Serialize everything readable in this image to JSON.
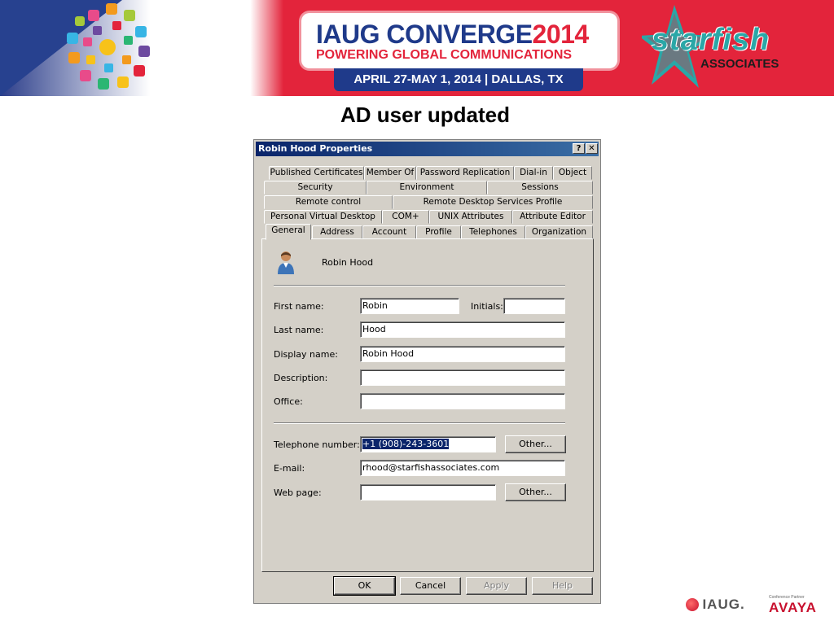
{
  "banner": {
    "title_main": "IAUG CONVERGE",
    "title_year": "2014",
    "subtitle": "POWERING GLOBAL COMMUNICATIONS",
    "dates": "APRIL 27-MAY 1, 2014  |  DALLAS, TX",
    "sponsor_name": "starfish",
    "sponsor_sub": "ASSOCIATES"
  },
  "slide": {
    "title": "AD user updated"
  },
  "dialog": {
    "title": "Robin Hood Properties",
    "help_glyph": "?",
    "close_glyph": "✕",
    "tabs_row1": [
      "Published Certificates",
      "Member Of",
      "Password Replication",
      "Dial-in",
      "Object"
    ],
    "tabs_row2": [
      "Security",
      "Environment",
      "Sessions"
    ],
    "tabs_row3": [
      "Remote control",
      "Remote Desktop Services Profile"
    ],
    "tabs_row4": [
      "Personal Virtual Desktop",
      "COM+",
      "UNIX Attributes",
      "Attribute Editor"
    ],
    "tabs_row5": [
      "General",
      "Address",
      "Account",
      "Profile",
      "Telephones",
      "Organization"
    ],
    "active_tab": "General",
    "user_display": "Robin Hood",
    "labels": {
      "first_name": "First name:",
      "initials": "Initials:",
      "last_name": "Last name:",
      "display_name": "Display name:",
      "description": "Description:",
      "office": "Office:",
      "telephone": "Telephone number:",
      "email": "E-mail:",
      "web_page": "Web page:"
    },
    "values": {
      "first_name": "Robin",
      "initials": "",
      "last_name": "Hood",
      "display_name": "Robin Hood",
      "description": "",
      "office": "",
      "telephone": "+1 (908)-243-3601",
      "email": "rhood@starfishassociates.com",
      "web_page": ""
    },
    "buttons": {
      "other_phone": "Other...",
      "other_web": "Other...",
      "ok": "OK",
      "cancel": "Cancel",
      "apply": "Apply",
      "help": "Help"
    }
  },
  "footer": {
    "iaug": "IAUG.",
    "avaya_partner": "Conference Partner",
    "avaya": "AVAYA"
  },
  "colors": {
    "banner_red": "#e3243b",
    "banner_blue": "#1f3a8a",
    "dialog_face": "#d4d0c8",
    "titlebar": "#0a246a",
    "avaya_red": "#c8102e"
  }
}
